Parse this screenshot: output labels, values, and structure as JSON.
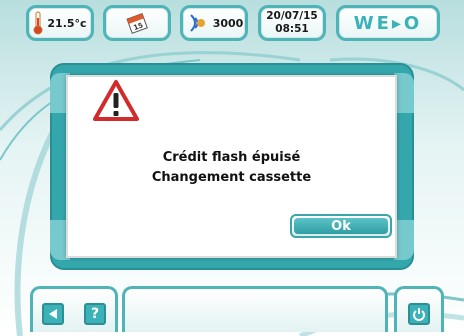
{
  "topbar": {
    "temperature": "21.5°c",
    "counter": "3000",
    "date": "20/07/15",
    "time": "08:51",
    "logo": "WE▸O"
  },
  "dialog": {
    "icon": "warning-triangle-icon",
    "line1": "Crédit flash épuisé",
    "line2": "Changement cassette",
    "ok_label": "Ok"
  },
  "bottombar": {
    "back_icon": "back-arrow-icon",
    "help_label": "?",
    "power_icon": "power-icon"
  },
  "colors": {
    "accent": "#3ab2b7",
    "accent_dark": "#2a8f94",
    "warning_red": "#d22b2b"
  }
}
